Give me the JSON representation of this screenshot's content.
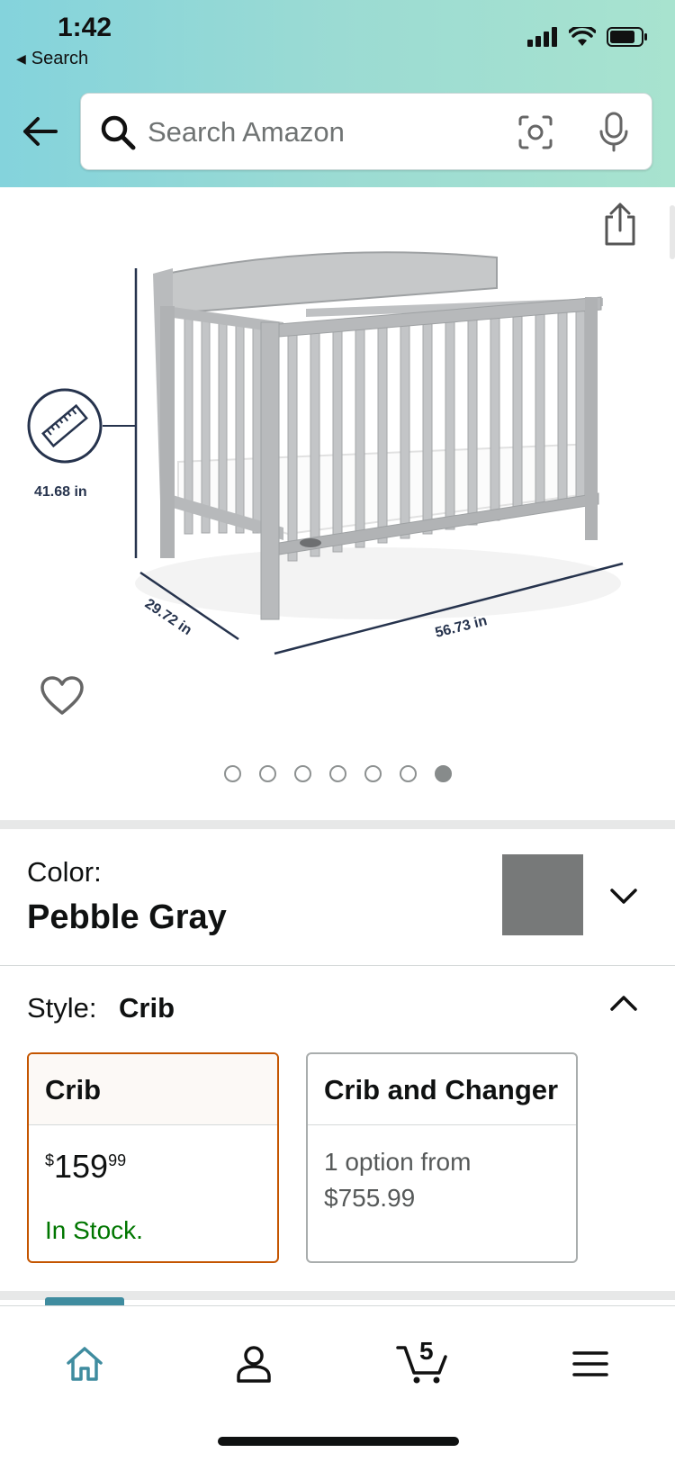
{
  "status_bar": {
    "time": "1:42",
    "back_label": "Search",
    "icons": [
      "signal-icon",
      "wifi-icon",
      "battery-icon"
    ]
  },
  "header": {
    "back_icon": "back-arrow-icon",
    "search": {
      "placeholder": "Search Amazon",
      "search_icon": "search-icon",
      "camera_icon": "camera-scan-icon",
      "mic_icon": "microphone-icon"
    },
    "gradient_colors": [
      "#84d3dc",
      "#a8e3cf"
    ]
  },
  "gallery": {
    "share_icon": "share-icon",
    "wishlist_icon": "heart-icon",
    "dimension_labels": {
      "height": "41.68 in",
      "depth": "29.72 in",
      "width": "56.73 in"
    },
    "page_count": 7,
    "active_page": 7
  },
  "color_selector": {
    "label": "Color:",
    "value": "Pebble Gray",
    "swatch_color": "#777979",
    "expand_icon": "chevron-down-icon"
  },
  "style_selector": {
    "label": "Style:",
    "value": "Crib",
    "collapse_icon": "chevron-up-icon",
    "options": [
      {
        "name": "Crib",
        "price_symbol": "$",
        "price_whole": "159",
        "price_fraction": "99",
        "availability": "In Stock.",
        "selected": true
      },
      {
        "name": "Crib and Changer",
        "offer_line1": "1 option from",
        "offer_line2": "$755.99",
        "selected": false
      }
    ]
  },
  "tab_bar": {
    "items": [
      {
        "name": "home",
        "icon": "home-icon",
        "active": true
      },
      {
        "name": "account",
        "icon": "person-icon",
        "active": false
      },
      {
        "name": "cart",
        "icon": "cart-icon",
        "active": false
      },
      {
        "name": "menu",
        "icon": "hamburger-menu-icon",
        "active": false
      }
    ],
    "cart_count": "5",
    "accent_color": "#3f8c9f"
  }
}
